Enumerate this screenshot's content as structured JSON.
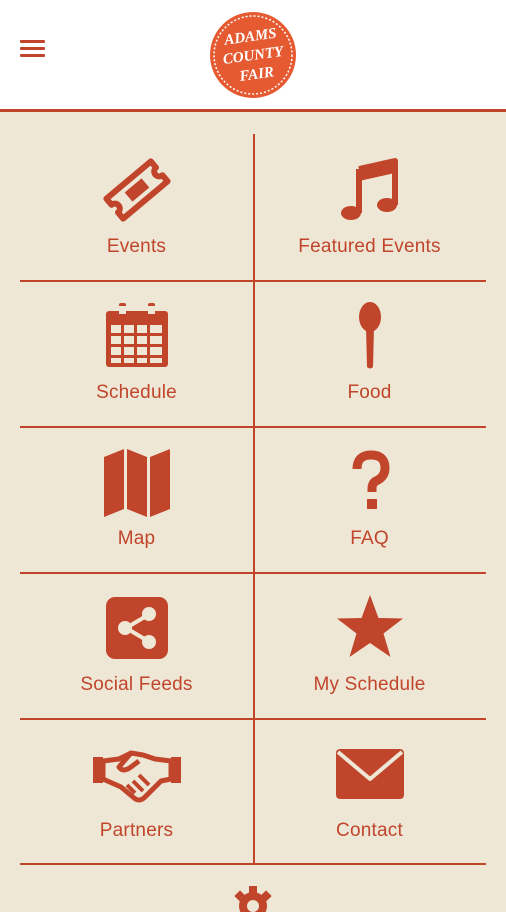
{
  "header": {
    "logo_line1": "ADAMS",
    "logo_line2": "COUNTY",
    "logo_line3": "FAIR"
  },
  "menu": {
    "items": [
      {
        "label": "Events",
        "icon": "ticket-icon"
      },
      {
        "label": "Featured Events",
        "icon": "music-note-icon"
      },
      {
        "label": "Schedule",
        "icon": "calendar-icon"
      },
      {
        "label": "Food",
        "icon": "spoon-icon"
      },
      {
        "label": "Map",
        "icon": "map-icon"
      },
      {
        "label": "FAQ",
        "icon": "question-icon"
      },
      {
        "label": "Social Feeds",
        "icon": "share-icon"
      },
      {
        "label": "My Schedule",
        "icon": "star-icon"
      },
      {
        "label": "Partners",
        "icon": "handshake-icon"
      },
      {
        "label": "Contact",
        "icon": "envelope-icon"
      }
    ]
  },
  "colors": {
    "accent": "#c0452b",
    "background": "#efe7d6",
    "header_background": "#ffffff"
  }
}
